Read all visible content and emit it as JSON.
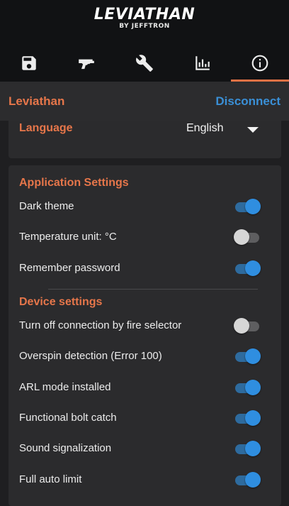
{
  "logo": {
    "name": "LEVIATHAN",
    "sub": "BY JEFFTRON"
  },
  "tabs": [
    {
      "icon": "save-icon",
      "active": false
    },
    {
      "icon": "gun-icon",
      "active": false
    },
    {
      "icon": "wrench-icon",
      "active": false
    },
    {
      "icon": "bar-chart-icon",
      "active": false
    },
    {
      "icon": "info-icon",
      "active": true
    }
  ],
  "topbar": {
    "device_name": "Leviathan",
    "disconnect_label": "Disconnect"
  },
  "language": {
    "label": "Language",
    "value": "English"
  },
  "app_settings": {
    "title": "Application Settings",
    "dark_theme": {
      "label": "Dark theme",
      "on": true
    },
    "temperature": {
      "label": "Temperature unit:  °C",
      "on": false
    },
    "remember_password": {
      "label": "Remember password",
      "on": true
    }
  },
  "device_settings": {
    "title": "Device settings",
    "fire_selector": {
      "label": "Turn off connection by fire selector",
      "on": false
    },
    "overspin": {
      "label": "Overspin detection (Error 100)",
      "on": true
    },
    "arl_mode": {
      "label": "ARL mode installed",
      "on": true
    },
    "bolt_catch": {
      "label": "Functional bolt catch",
      "on": true
    },
    "sound": {
      "label": "Sound signalization",
      "on": true
    },
    "full_auto": {
      "label": "Full auto limit",
      "on": true
    }
  },
  "colors": {
    "accent": "#e6764a",
    "link": "#3a8fd6",
    "toggle_on": "#2f8ee0",
    "background": "#1f1f21",
    "header": "#111214"
  }
}
